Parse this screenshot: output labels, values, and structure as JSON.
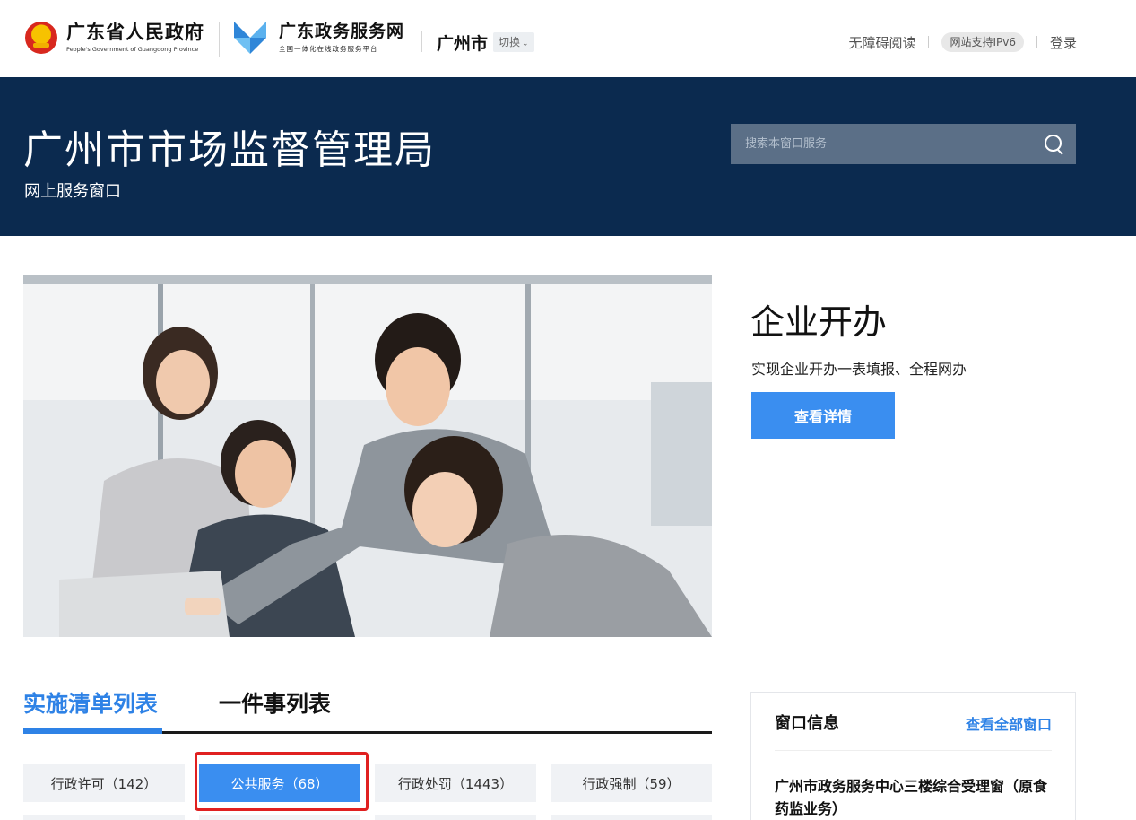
{
  "header": {
    "gov_title": "广东省人民政府",
    "gov_subtitle": "People's Government of Guangdong Province",
    "platform_title": "广东政务服务网",
    "platform_subtitle": "全国一体化在线政务服务平台",
    "city": "广州市",
    "switch_label": "切换",
    "links": {
      "accessibility": "无障碍阅读",
      "ipv6": "网站支持IPv6",
      "login": "登录"
    }
  },
  "banner": {
    "title": "广州市市场监督管理局",
    "subtitle": "网上服务窗口",
    "search_placeholder": "搜索本窗口服务"
  },
  "hero": {
    "title": "企业开办",
    "description": "实现企业开办一表填报、全程网办",
    "button": "查看详情"
  },
  "tabs": {
    "active": "实施清单列表",
    "other": "一件事列表"
  },
  "categories": [
    {
      "label": "行政许可（142）",
      "active": false
    },
    {
      "label": "公共服务（68）",
      "active": true
    },
    {
      "label": "行政处罚（1443）",
      "active": false
    },
    {
      "label": "行政强制（59）",
      "active": false
    }
  ],
  "window_info": {
    "title": "窗口信息",
    "more": "查看全部窗口",
    "first_item": "广州市政务服务中心三楼综合受理窗（原食药监业务）"
  },
  "colors": {
    "banner_bg": "#0b2a4f",
    "accent": "#2e82e6",
    "button": "#3a8ef0",
    "highlight": "#e02020"
  },
  "icons": {
    "emblem": "gov-emblem-icon",
    "platform": "pinwheel-logo-icon",
    "search": "search-icon",
    "switch": "chevron-down-icon"
  }
}
